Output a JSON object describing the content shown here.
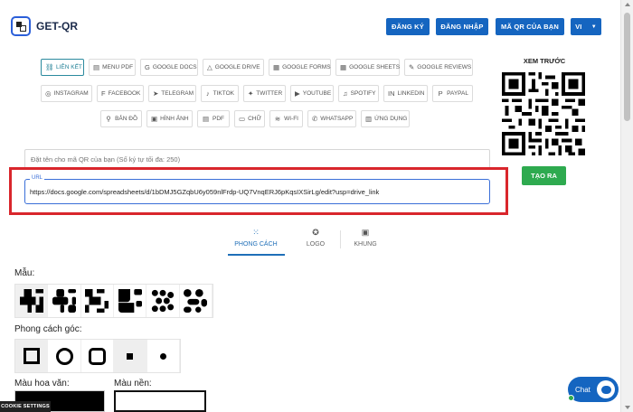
{
  "header": {
    "logo_text": "GET-QR",
    "buttons": [
      {
        "label": "ĐĂNG KÝ"
      },
      {
        "label": "ĐĂNG NHẬP"
      },
      {
        "label": "MÃ QR CỦA BẠN"
      },
      {
        "label": "VI"
      }
    ]
  },
  "types": {
    "row1": [
      {
        "label": "LIÊN KẾT",
        "icon": "link-icon",
        "active": true
      },
      {
        "label": "MENU PDF",
        "icon": "menu-pdf-icon"
      },
      {
        "label": "GOOGLE DOCS",
        "icon": "google-docs-icon"
      },
      {
        "label": "GOOGLE DRIVE",
        "icon": "google-drive-icon"
      },
      {
        "label": "GOOGLE FORMS",
        "icon": "google-forms-icon"
      },
      {
        "label": "GOOGLE SHEETS",
        "icon": "google-sheets-icon"
      },
      {
        "label": "GOOGLE REVIEWS",
        "icon": "google-reviews-icon"
      }
    ],
    "row2": [
      {
        "label": "INSTAGRAM",
        "icon": "instagram-icon"
      },
      {
        "label": "FACEBOOK",
        "icon": "facebook-icon"
      },
      {
        "label": "TELEGRAM",
        "icon": "telegram-icon"
      },
      {
        "label": "TIKTOK",
        "icon": "tiktok-icon"
      },
      {
        "label": "TWITTER",
        "icon": "twitter-icon"
      },
      {
        "label": "YOUTUBE",
        "icon": "youtube-icon"
      },
      {
        "label": "SPOTIFY",
        "icon": "spotify-icon"
      },
      {
        "label": "LINKEDIN",
        "icon": "linkedin-icon"
      },
      {
        "label": "PAYPAL",
        "icon": "paypal-icon"
      }
    ],
    "row3": [
      {
        "label": "BẢN ĐỒ",
        "icon": "map-pin-icon"
      },
      {
        "label": "HÌNH ẢNH",
        "icon": "image-icon"
      },
      {
        "label": "PDF",
        "icon": "pdf-icon"
      },
      {
        "label": "CHỮ",
        "icon": "text-icon"
      },
      {
        "label": "WI-FI",
        "icon": "wifi-icon"
      },
      {
        "label": "WHATSAPP",
        "icon": "whatsapp-icon"
      },
      {
        "label": "ỨNG DỤNG",
        "icon": "app-icon"
      }
    ]
  },
  "preview": {
    "title": "XEM TRƯỚC",
    "create_label": "TẠO RA"
  },
  "form": {
    "name_placeholder": "Đặt tên cho mã QR của bạn (Số ký tự tối đa: 250)",
    "url_label": "URL",
    "url_value": "https://docs.google.com/spreadsheets/d/1bDMJ5GZqbU6y059nlFrdp-UQ7VnqERJ6pKqsIXSirLg/edit?usp=drive_link"
  },
  "tabs": [
    {
      "label": "PHONG CÁCH",
      "icon": "style-grid-icon",
      "active": true
    },
    {
      "label": "LOGO",
      "icon": "logo-badge-icon"
    },
    {
      "label": "KHUNG",
      "icon": "frame-icon"
    }
  ],
  "style": {
    "pattern_label": "Mẫu:",
    "corner_label": "Phong cách góc:",
    "pattern_color_label": "Màu hoa văn:",
    "bg_color_label": "Màu nền:"
  },
  "colors": {
    "primary": "#1565c0",
    "create": "#2eaa4f",
    "highlight": "#d9262c",
    "pattern_color": "#000000",
    "bg_color": "#ffffff"
  },
  "cookie_label": "COOKIE SETTINGS",
  "chat_label": "Chat"
}
